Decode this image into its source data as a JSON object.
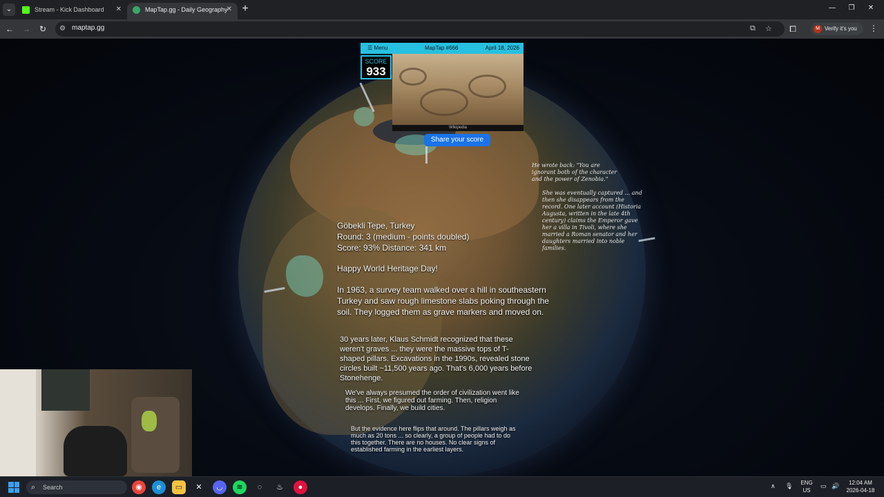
{
  "browser": {
    "tabs": [
      {
        "title": "Stream - Kick Dashboard",
        "active": false
      },
      {
        "title": "MapTap.gg - Daily Geography",
        "active": true
      }
    ],
    "url": "maptap.gg",
    "profile_label": "Verify it's you",
    "profile_initial": "M"
  },
  "maptap": {
    "menu_label": "Menu",
    "title": "MapTap #666",
    "date": "April 18, 2026",
    "score_label": "SCORE",
    "score_value": "933",
    "photo_credit": "Wikipedia",
    "share_button": "Share your score"
  },
  "round_info": {
    "place": "Göbekli Tepe, Turkey",
    "round": "Round: 3 (medium - points doubled)",
    "score_line": "Score: 93% Distance: 341 km",
    "greeting": "Happy World Heritage Day!",
    "para1": "In 1963, a survey team walked over a hill in southeastern Turkey and saw rough limestone slabs poking through the soil. They logged them as grave markers and moved on.",
    "para2": "30 years later, Klaus Schmidt recognized that these weren't graves ... they were the massive tops of T-shaped pillars. Excavations in the 1990s, revealed stone circles built ~11,500 years ago. That's 6,000 years before Stonehenge.",
    "para3": "We've always presumed the order of civilization went like this ... First, we figured out farming. Then, religion develops. Finally, we build cities.",
    "para4": "But the evidence here flips that around. The pillars weigh as much as 20 tons ... so clearly, a group of people had to do this together. There are no houses. No clear signs of established farming in the earliest layers."
  },
  "globe_text_right": {
    "block1": "He wrote back: \"You are ignorant both of the character and the power of Zenobia.\"",
    "block2": "She was eventually captured ... and then she disappears from the record. One later account (Historia Augusta, written in the late 4th century) claims the Emperor gave her a villa in Tivoli, where she married a Roman senator and her daughters married into noble families."
  },
  "taskbar": {
    "search_placeholder": "Search",
    "lang_line1": "ENG",
    "lang_line2": "US",
    "time": "12:04 AM",
    "date": "2026-04-18"
  }
}
